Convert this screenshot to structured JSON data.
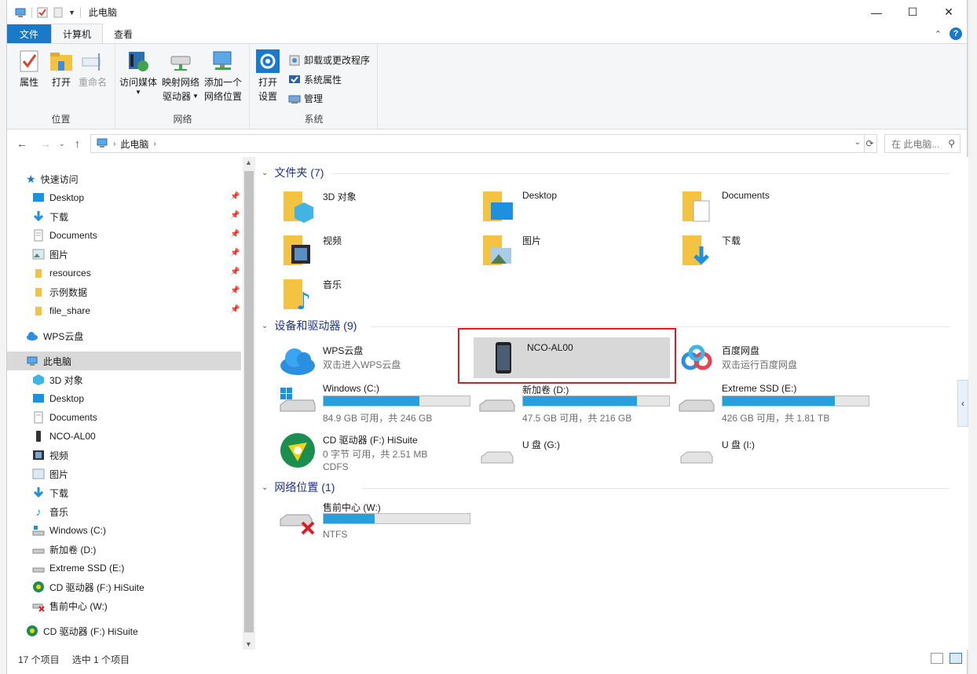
{
  "window": {
    "title": "此电脑"
  },
  "window_controls": {
    "minimize": "—",
    "maximize": "☐",
    "close": "✕"
  },
  "tabs": [
    {
      "label": "文件"
    },
    {
      "label": "计算机"
    },
    {
      "label": "查看"
    }
  ],
  "ribbon": {
    "location": {
      "label": "位置",
      "properties": "属性",
      "open": "打开",
      "rename": "重命名"
    },
    "network": {
      "label": "网络",
      "access_media": "访问媒体",
      "map_drive_1": "映射网络",
      "map_drive_2": "驱动器",
      "add_location_1": "添加一个",
      "add_location_2": "网络位置"
    },
    "system": {
      "label": "系统",
      "open_settings_1": "打开",
      "open_settings_2": "设置",
      "uninstall": "卸载或更改程序",
      "sys_props": "系统属性",
      "manage": "管理"
    }
  },
  "address": {
    "crumb": "此电脑",
    "search_placeholder": "在 此电脑..."
  },
  "nav": {
    "quick_access": "快速访问",
    "quick_items": [
      "Desktop",
      "下载",
      "Documents",
      "图片",
      "resources",
      "示例数据",
      "file_share"
    ],
    "wps_cloud": "WPS云盘",
    "this_pc": "此电脑",
    "pc_items": [
      "3D 对象",
      "Desktop",
      "Documents",
      "NCO-AL00",
      "视频",
      "图片",
      "下载",
      "音乐",
      "Windows (C:)",
      "新加卷 (D:)",
      "Extreme SSD (E:)",
      "CD 驱动器 (F:) HiSuite",
      "售前中心 (W:)"
    ],
    "extra_cd": "CD 驱动器 (F:) HiSuite"
  },
  "sections": {
    "folders": "文件夹 (7)",
    "devices": "设备和驱动器 (9)",
    "network": "网络位置 (1)"
  },
  "folders": [
    "3D 对象",
    "Desktop",
    "Documents",
    "视频",
    "图片",
    "下载",
    "音乐"
  ],
  "devices": {
    "wps": {
      "name": "WPS云盘",
      "sub": "双击进入WPS云盘"
    },
    "phone": {
      "name": "NCO-AL00"
    },
    "baidu": {
      "name": "百度网盘",
      "sub": "双击运行百度网盘"
    },
    "c": {
      "name": "Windows (C:)",
      "free": "84.9 GB 可用，共 246 GB",
      "used_fraction": 0.655
    },
    "d": {
      "name": "新加卷 (D:)",
      "free": "47.5 GB 可用，共 216 GB",
      "used_fraction": 0.78
    },
    "e": {
      "name": "Extreme SSD (E:)",
      "free": "426 GB 可用，共 1.81 TB",
      "used_fraction": 0.77
    },
    "f": {
      "name": "CD 驱动器 (F:) HiSuite",
      "free": "0 字节 可用，共 2.51 MB",
      "fs": "CDFS"
    },
    "g": {
      "name": "U 盘 (G:)"
    },
    "i": {
      "name": "U 盘 (I:)"
    }
  },
  "network_locations": {
    "w": {
      "name": "售前中心 (W:)",
      "fs": "NTFS",
      "used_fraction": 0.35
    }
  },
  "status": {
    "count": "17 个项目",
    "selected": "选中 1 个项目"
  },
  "colors": {
    "accent": "#1979ca",
    "bar_fill": "#26a0da",
    "section_title": "#1e3287",
    "highlight": "#e01b24"
  }
}
